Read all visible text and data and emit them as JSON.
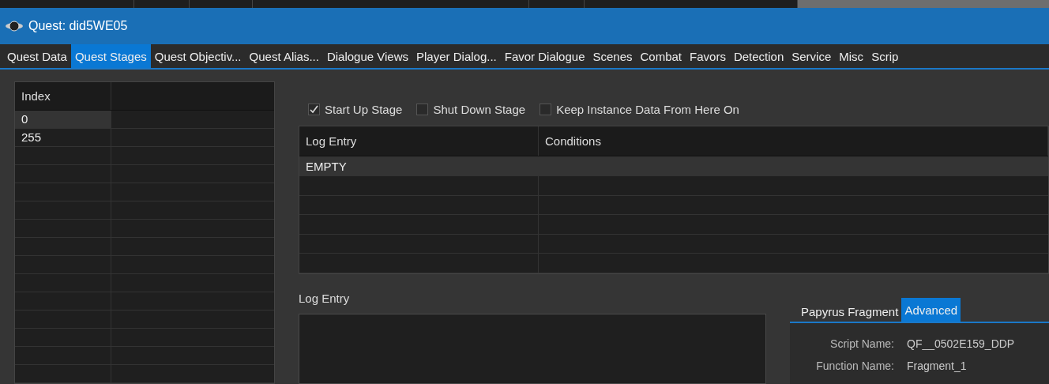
{
  "window": {
    "title": "Quest: did5WE05"
  },
  "tabs": [
    {
      "label": "Quest Data",
      "selected": false
    },
    {
      "label": "Quest Stages",
      "selected": true
    },
    {
      "label": "Quest Objectiv...",
      "selected": false
    },
    {
      "label": "Quest Alias...",
      "selected": false
    },
    {
      "label": "Dialogue Views",
      "selected": false
    },
    {
      "label": "Player Dialog...",
      "selected": false
    },
    {
      "label": "Favor Dialogue",
      "selected": false
    },
    {
      "label": "Scenes",
      "selected": false
    },
    {
      "label": "Combat",
      "selected": false
    },
    {
      "label": "Favors",
      "selected": false
    },
    {
      "label": "Detection",
      "selected": false
    },
    {
      "label": "Service",
      "selected": false
    },
    {
      "label": "Misc",
      "selected": false
    },
    {
      "label": "Scrip",
      "selected": false
    }
  ],
  "stages": {
    "columns": [
      "Index"
    ],
    "rows": [
      {
        "index": "0",
        "selected": true
      },
      {
        "index": "255",
        "selected": false
      }
    ]
  },
  "options": [
    {
      "label": "Start Up Stage",
      "checked": true
    },
    {
      "label": "Shut Down Stage",
      "checked": false
    },
    {
      "label": "Keep Instance Data From Here On",
      "checked": false
    }
  ],
  "log_table": {
    "columns": [
      "Log Entry",
      "Conditions"
    ],
    "rows": [
      {
        "log_entry": "EMPTY",
        "selected": true
      }
    ]
  },
  "log_entry": {
    "label": "Log Entry"
  },
  "fragment_tabs": [
    {
      "label": "Papyrus Fragment",
      "selected": false
    },
    {
      "label": "Advanced",
      "selected": true
    }
  ],
  "fragment": [
    {
      "label": "Script Name:",
      "value": "QF__0502E159_DDP"
    },
    {
      "label": "Function Name:",
      "value": "Fragment_1"
    }
  ]
}
